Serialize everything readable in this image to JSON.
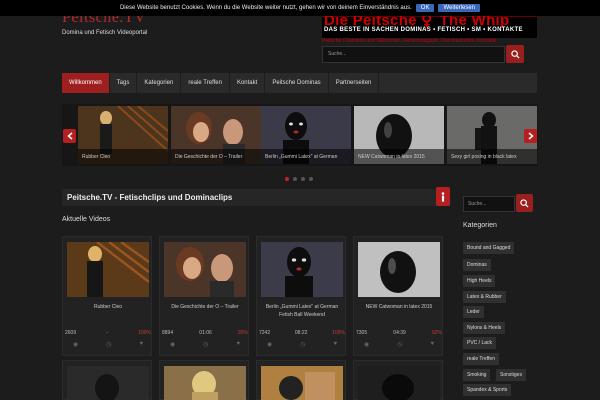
{
  "cookie": {
    "text": "Diese Website benutzt Cookies. Wenn du die Website weiter nutzt, gehen wir von deinem Einverständnis aus.",
    "ok": "OK",
    "more": "Weiterlesen"
  },
  "header": {
    "logo": "Peitsche.TV",
    "tagline": "Domina und Fetisch Videoportal",
    "brand_big": "Die Peitsche ⚥ The Whip",
    "brand_sub": "DAS BESTE IN SACHEN DOMINAS • FETISCH • SM • KONTAKTE",
    "brand_sub2": "Peitsche | Dominas und Sklavinnen, Fetischmagazin, Dominastudios, Kontakte",
    "search_placeholder": "Suche...",
    "search_icon": "search-icon"
  },
  "nav": [
    {
      "label": "Willkommen",
      "active": true
    },
    {
      "label": "Tags",
      "active": false
    },
    {
      "label": "Kategorien",
      "active": false
    },
    {
      "label": "reale Treffen",
      "active": false
    },
    {
      "label": "Kontakt",
      "active": false
    },
    {
      "label": "Peitsche Dominas",
      "active": false
    },
    {
      "label": "Partnerseiten",
      "active": false
    }
  ],
  "slider": {
    "slides": [
      {
        "caption": "Rubber Cleo"
      },
      {
        "caption": "Die Geschichte der O – Trailer"
      },
      {
        "caption": "Berlin „Gummi Latex\" at German"
      },
      {
        "caption": "NEW Catwoman in latex 2015"
      },
      {
        "caption": "Sexy girl posing in black latex"
      }
    ],
    "active_dot": 0,
    "dot_count": 4
  },
  "page_title": "Peitsche.TV - Fetischclips und Dominaclips",
  "section_title": "Aktuelle Videos",
  "videos": [
    {
      "title": "Rubber Cleo",
      "views": "2609",
      "duration": "-",
      "rating": "100%"
    },
    {
      "title": "Die Geschichte der O – Trailer",
      "views": "8894",
      "duration": "01:06",
      "rating": "93%"
    },
    {
      "title": "Berlin „Gummi Latex\" at German Fetish Ball Weekend",
      "views": "7242",
      "duration": "08:22",
      "rating": "100%"
    },
    {
      "title": "NEW Catwoman in latex 2015",
      "views": "7305",
      "duration": "04:39",
      "rating": "92%"
    }
  ],
  "sidebar": {
    "search_placeholder": "Suche...",
    "categories_title": "Kategorien",
    "tags": [
      "Bound and Gagged",
      "Dominas",
      "High Heels",
      "Latex & Rubber",
      "Leder",
      "Nylons & Heels",
      "PVC / Lack",
      "reale Treffen",
      "Smoking",
      "Sonstiges",
      "Spandex & Sports"
    ]
  },
  "colors": {
    "accent": "#9e1f1f",
    "background": "#1c1c1c",
    "rating": "#c93a3a"
  }
}
